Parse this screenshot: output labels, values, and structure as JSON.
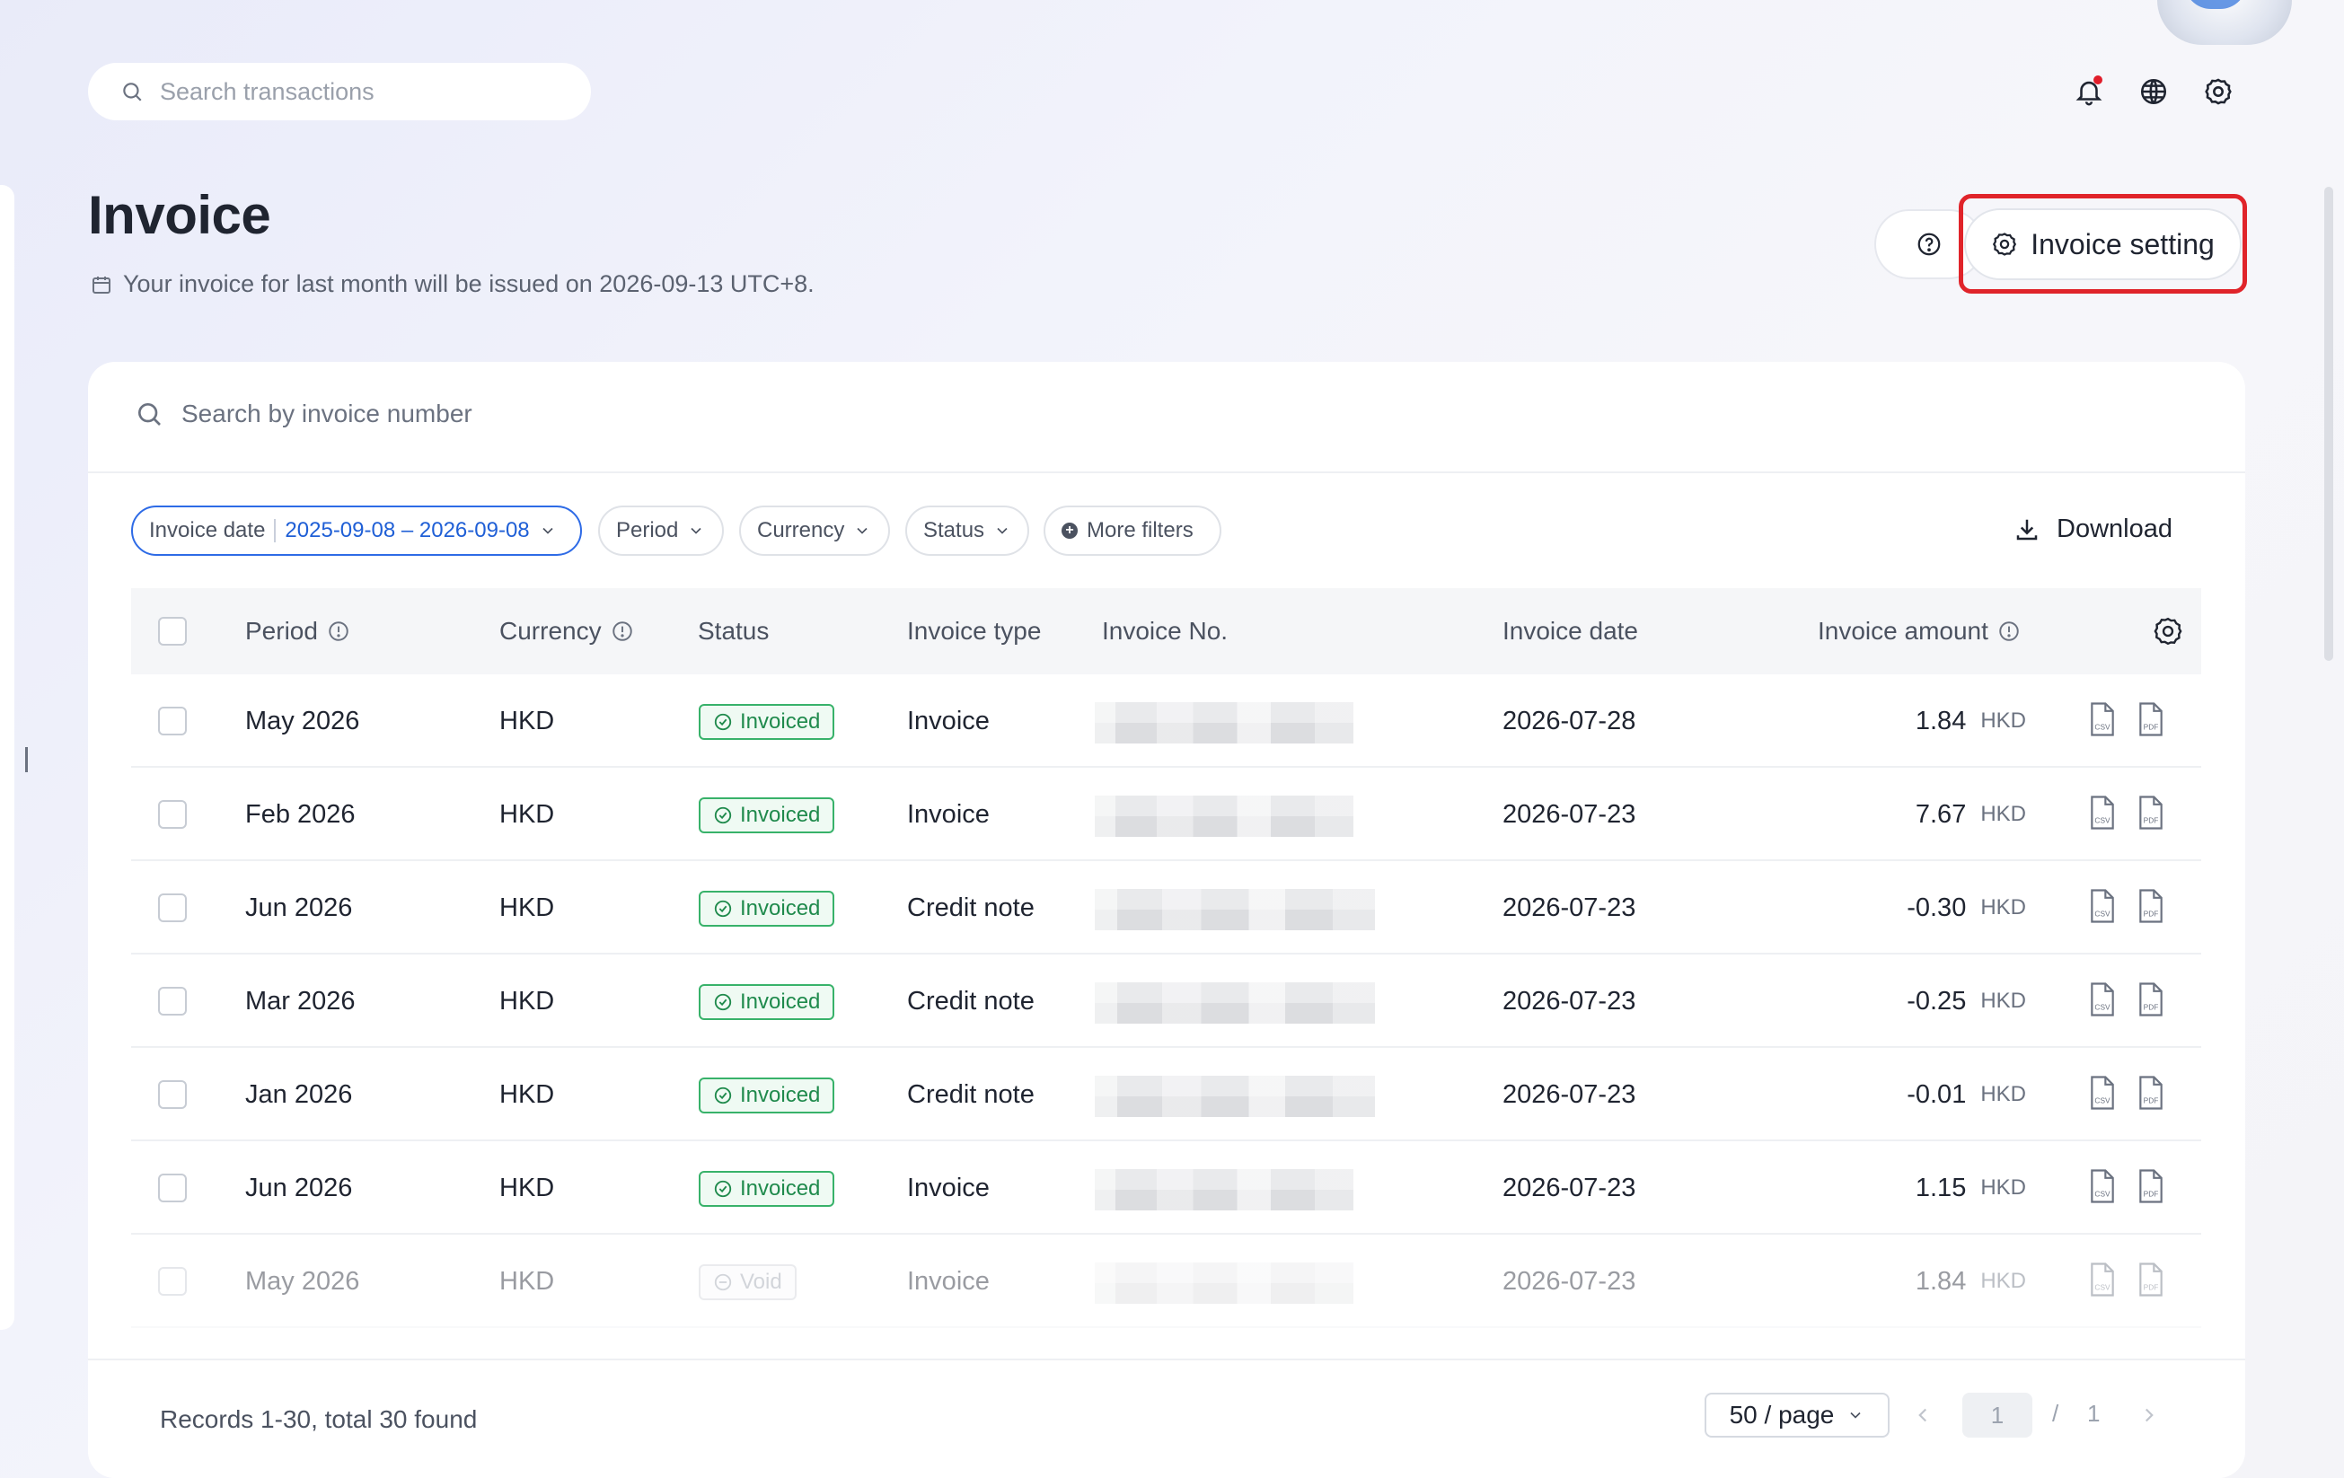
{
  "top_bar": {
    "search_placeholder": "Search transactions"
  },
  "header": {
    "title": "Invoice",
    "subtitle": "Your invoice for last month will be issued on 2026-09-13 UTC+8.",
    "invoice_setting_label": "Invoice setting"
  },
  "toolbar": {
    "search_placeholder": "Search by invoice number",
    "filters": {
      "invoice_date_label": "Invoice date",
      "invoice_date_value": "2025-09-08 – 2026-09-08",
      "period": "Period",
      "currency": "Currency",
      "status": "Status",
      "more_filters": "More filters"
    },
    "download_label": "Download"
  },
  "table": {
    "columns": {
      "period": "Period",
      "currency": "Currency",
      "status": "Status",
      "invoice_type": "Invoice type",
      "invoice_no": "Invoice No.",
      "invoice_date": "Invoice date",
      "invoice_amount": "Invoice amount"
    },
    "rows": [
      {
        "period": "May 2026",
        "currency": "HKD",
        "status": "Invoiced",
        "type": "Invoice",
        "date": "2026-07-28",
        "amount": "1.84",
        "amount_currency": "HKD"
      },
      {
        "period": "Feb 2026",
        "currency": "HKD",
        "status": "Invoiced",
        "type": "Invoice",
        "date": "2026-07-23",
        "amount": "7.67",
        "amount_currency": "HKD"
      },
      {
        "period": "Jun 2026",
        "currency": "HKD",
        "status": "Invoiced",
        "type": "Credit note",
        "date": "2026-07-23",
        "amount": "-0.30",
        "amount_currency": "HKD"
      },
      {
        "period": "Mar 2026",
        "currency": "HKD",
        "status": "Invoiced",
        "type": "Credit note",
        "date": "2026-07-23",
        "amount": "-0.25",
        "amount_currency": "HKD"
      },
      {
        "period": "Jan 2026",
        "currency": "HKD",
        "status": "Invoiced",
        "type": "Credit note",
        "date": "2026-07-23",
        "amount": "-0.01",
        "amount_currency": "HKD"
      },
      {
        "period": "Jun 2026",
        "currency": "HKD",
        "status": "Invoiced",
        "type": "Invoice",
        "date": "2026-07-23",
        "amount": "1.15",
        "amount_currency": "HKD"
      },
      {
        "period": "May 2026",
        "currency": "HKD",
        "status": "Void",
        "type": "Invoice",
        "date": "2026-07-23",
        "amount": "1.84",
        "amount_currency": "HKD"
      }
    ],
    "file_icons": [
      "csv",
      "pdf"
    ]
  },
  "footer": {
    "records_text": "Records 1-30, total 30 found",
    "page_size": "50 / page",
    "current_page": "1",
    "page_separator": "/",
    "total_pages": "1"
  },
  "colors": {
    "accent_blue": "#1f5fd6",
    "status_green": "#1f8a4c",
    "highlight_red": "#e0242a"
  }
}
